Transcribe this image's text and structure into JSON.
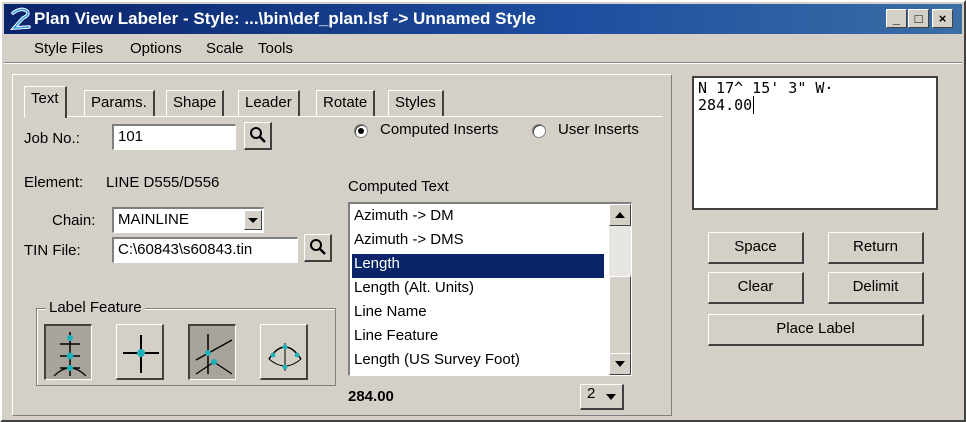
{
  "window": {
    "title": "Plan View Labeler - Style: ...\\bin\\def_plan.lsf -> Unnamed Style",
    "controls": {
      "minimize": "_",
      "maximize": "□",
      "close": "×"
    }
  },
  "menu": [
    {
      "label": "Style Files"
    },
    {
      "label": "Options"
    },
    {
      "label": "Scale"
    },
    {
      "label": "Tools"
    }
  ],
  "tabs": [
    {
      "label": "Text",
      "active": true
    },
    {
      "label": "Params."
    },
    {
      "label": "Shape"
    },
    {
      "label": "Leader"
    },
    {
      "label": "Rotate"
    },
    {
      "label": "Styles"
    }
  ],
  "form": {
    "job_label": "Job No.:",
    "job_value": "101",
    "element_label": "Element:",
    "element_value": "LINE D555/D556",
    "chain_label": "Chain:",
    "chain_value": "MAINLINE",
    "tin_label": "TIN File:",
    "tin_value": "C:\\60843\\s60843.tin"
  },
  "inserts": {
    "computed_label": "Computed Inserts",
    "user_label": "User Inserts",
    "selected": "computed"
  },
  "computed_text": {
    "title": "Computed Text",
    "items": [
      "Azimuth -> DM",
      "Azimuth -> DMS",
      "Length",
      "Length (Alt. Units)",
      "Line Name",
      "Line Feature",
      "Length (US Survey Foot)"
    ],
    "selected_index": 2,
    "value": "284.00",
    "precision": "2"
  },
  "label_feature": {
    "title": "Label Feature",
    "icons": [
      "feature-points-icon",
      "crosshair-point-icon",
      "intersect-lines-icon",
      "curve-points-icon"
    ],
    "pressed": [
      0,
      2
    ]
  },
  "label_text": {
    "line1": "N 17^ 15' 3\" W·",
    "line2": "284.00"
  },
  "buttons": {
    "space": "Space",
    "return": "Return",
    "clear": "Clear",
    "delimit": "Delimit",
    "place_label": "Place Label"
  },
  "colors": {
    "title_bar": "#0a246a",
    "selection": "#0a246a",
    "face": "#d4d0c8"
  }
}
